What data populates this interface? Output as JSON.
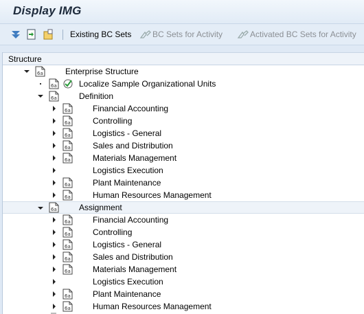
{
  "title": "Display IMG",
  "toolbar": {
    "existing_bc_sets": "Existing BC Sets",
    "bc_sets_for_activity": "BC Sets for Activity",
    "activated_bc_sets_for_activity": "Activated BC Sets for Activity"
  },
  "tree": {
    "header": "Structure",
    "root": {
      "label": "Enterprise Structure",
      "expanded": true
    },
    "localize": {
      "label": "Localize Sample Organizational Units"
    },
    "definition": {
      "label": "Definition",
      "expanded": true,
      "items": [
        {
          "label": "Financial Accounting",
          "has_doc_icon": true
        },
        {
          "label": "Controlling",
          "has_doc_icon": true
        },
        {
          "label": "Logistics - General",
          "has_doc_icon": true
        },
        {
          "label": "Sales and Distribution",
          "has_doc_icon": true
        },
        {
          "label": "Materials Management",
          "has_doc_icon": true
        },
        {
          "label": "Logistics Execution",
          "has_doc_icon": false
        },
        {
          "label": "Plant Maintenance",
          "has_doc_icon": true
        },
        {
          "label": "Human Resources Management",
          "has_doc_icon": true
        }
      ]
    },
    "assignment": {
      "label": "Assignment",
      "expanded": true,
      "items": [
        {
          "label": "Financial Accounting",
          "has_doc_icon": true
        },
        {
          "label": "Controlling",
          "has_doc_icon": true
        },
        {
          "label": "Logistics - General",
          "has_doc_icon": true
        },
        {
          "label": "Sales and Distribution",
          "has_doc_icon": true
        },
        {
          "label": "Materials Management",
          "has_doc_icon": true
        },
        {
          "label": "Logistics Execution",
          "has_doc_icon": false
        },
        {
          "label": "Plant Maintenance",
          "has_doc_icon": true
        },
        {
          "label": "Human Resources Management",
          "has_doc_icon": true
        }
      ]
    }
  },
  "colors": {
    "background": "#dfe9f5",
    "tree_background": "#ffffff",
    "header_background": "#eef3f9",
    "disabled_text": "#8b8f94"
  }
}
